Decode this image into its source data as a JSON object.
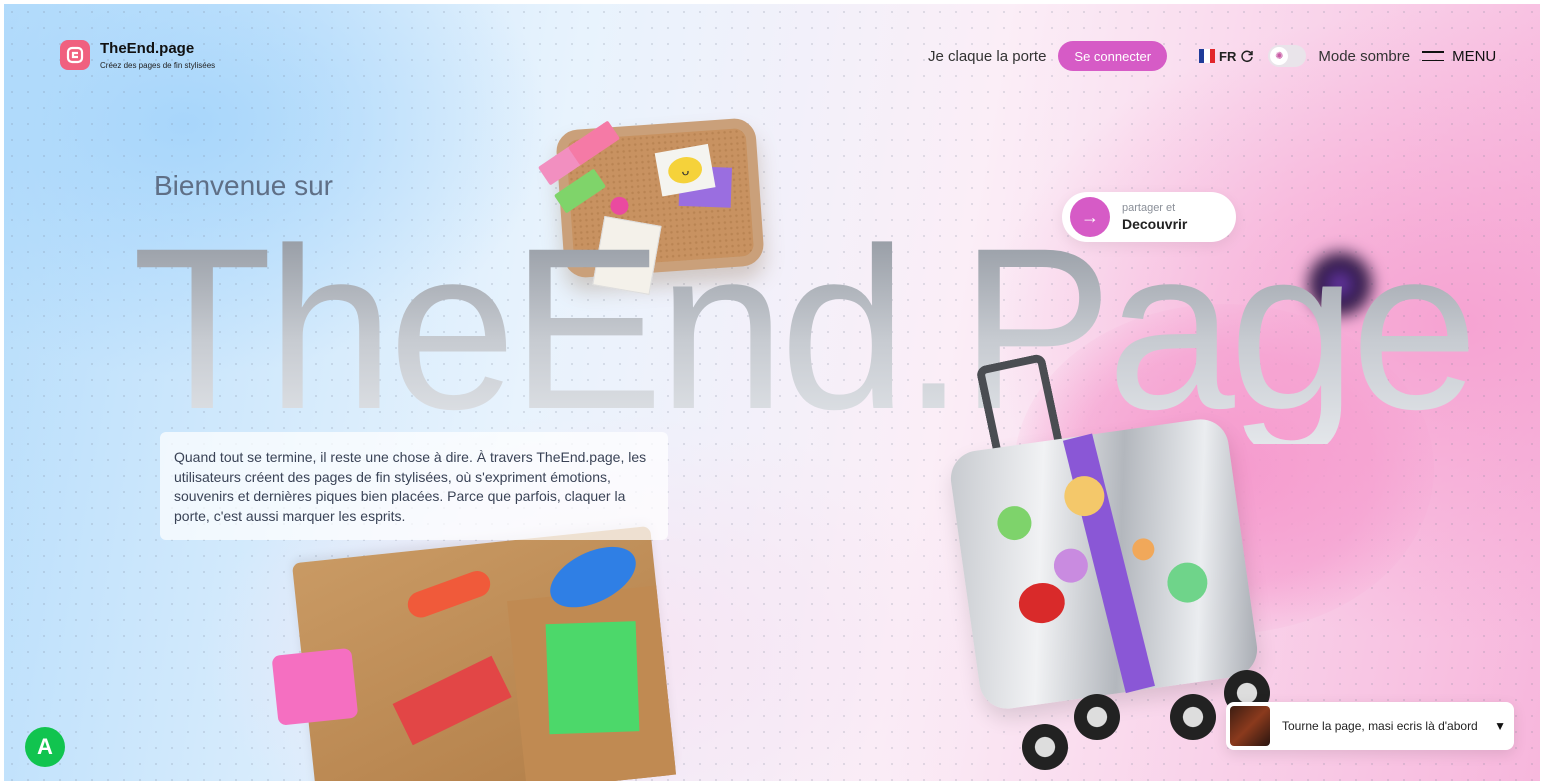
{
  "header": {
    "brand_name": "TheEnd.page",
    "brand_tagline": "Créez des pages de fin stylisées",
    "nav_link": "Je claque la porte",
    "login_label": "Se connecter",
    "language": "FR",
    "dark_mode_label": "Mode sombre",
    "menu_label": "MENU"
  },
  "hero": {
    "welcome": "Bienvenue sur",
    "big_title": "TheEnd.Page",
    "intro": "Quand tout se termine, il reste une chose à dire. À travers TheEnd.page, les utilisateurs créent des pages de fin stylisées, où s'expriment émotions, souvenirs et dernières piques bien placées. Parce que parfois, claquer la porte, c'est aussi marquer les esprits.",
    "discover_small": "partager et",
    "discover_strong": "Decouvrir"
  },
  "widgets": {
    "avatar_letter": "A",
    "player_text": "Tourne la page, masi ecris là d'abord"
  },
  "colors": {
    "accent": "#d65bc6",
    "logo": "#f0607f",
    "avatar": "#11c44f"
  },
  "icons": {
    "logo": "logo-icon",
    "refresh": "refresh-icon",
    "arrow": "arrow-right-icon",
    "menu": "hamburger-icon",
    "chevron": "chevron-down-icon"
  }
}
